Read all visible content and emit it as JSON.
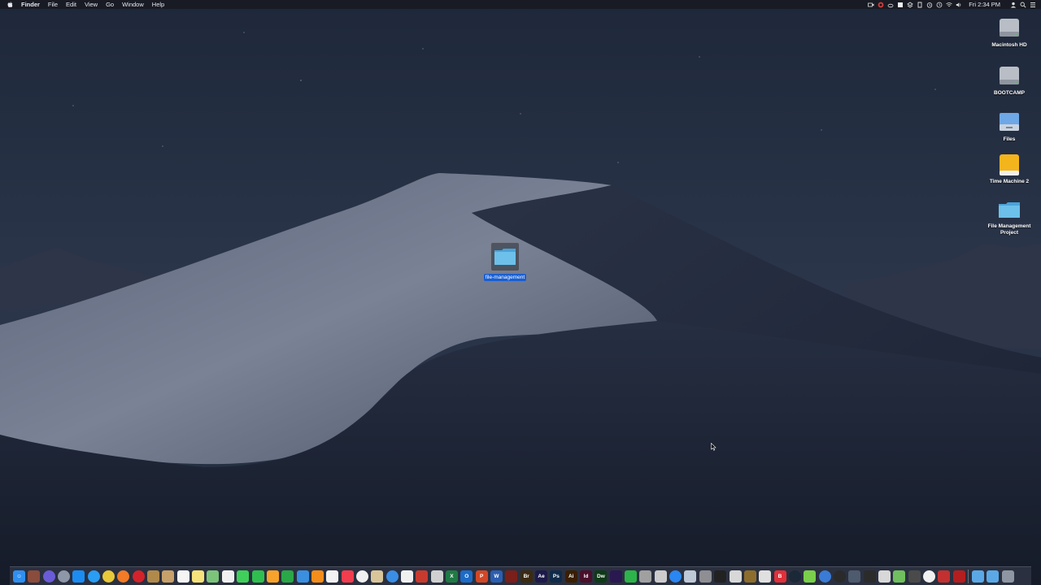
{
  "menubar": {
    "apple_icon": "apple-logo-icon",
    "items": [
      "Finder",
      "File",
      "Edit",
      "View",
      "Go",
      "Window",
      "Help"
    ],
    "status_icons": [
      "camera-icon",
      "creative-cloud-icon",
      "cloud-icon",
      "dropbox-icon",
      "box-icon",
      "backblaze-icon",
      "alarm-icon",
      "time-machine-icon",
      "wifi-icon",
      "volume-icon"
    ],
    "clock": "Fri 2:34 PM",
    "right_icons": [
      "user-icon",
      "spotlight-search-icon",
      "notification-center-icon"
    ]
  },
  "desktop_icons": [
    {
      "name": "macintosh-hd-drive",
      "label": "Macintosh HD",
      "kind": "internal-drive"
    },
    {
      "name": "bootcamp-drive",
      "label": "BOOTCAMP",
      "kind": "internal-drive"
    },
    {
      "name": "files-drive",
      "label": "Files",
      "kind": "network-drive"
    },
    {
      "name": "time-machine-drive",
      "label": "Time Machine 2",
      "kind": "external-drive"
    },
    {
      "name": "file-management-project-folder",
      "label": "File Management Project",
      "kind": "folder"
    }
  ],
  "selected_folder": {
    "label": "file-management"
  },
  "dock": {
    "apps": [
      {
        "name": "finder",
        "color": "#2f8ff0",
        "glyph": "☺"
      },
      {
        "name": "photo-booth",
        "color": "#8a4c3c",
        "glyph": ""
      },
      {
        "name": "siri",
        "color": "#6a5cd6",
        "glyph": ""
      },
      {
        "name": "launchpad",
        "color": "#8d97a8",
        "glyph": ""
      },
      {
        "name": "app-store-blue",
        "color": "#1b8cf2",
        "glyph": ""
      },
      {
        "name": "safari",
        "color": "#2a9df4",
        "glyph": ""
      },
      {
        "name": "chrome",
        "color": "#e8c93a",
        "glyph": ""
      },
      {
        "name": "firefox",
        "color": "#f17b26",
        "glyph": ""
      },
      {
        "name": "opera",
        "color": "#d4222b",
        "glyph": ""
      },
      {
        "name": "notes-brown",
        "color": "#b08a4a",
        "glyph": ""
      },
      {
        "name": "contacts",
        "color": "#c7a06a",
        "glyph": ""
      },
      {
        "name": "calendar",
        "color": "#f5f5f5",
        "glyph": ""
      },
      {
        "name": "notes",
        "color": "#f6e27a",
        "glyph": ""
      },
      {
        "name": "maps",
        "color": "#7cc47a",
        "glyph": ""
      },
      {
        "name": "photos",
        "color": "#f0f0f0",
        "glyph": ""
      },
      {
        "name": "messages",
        "color": "#3fcf5a",
        "glyph": ""
      },
      {
        "name": "facetime",
        "color": "#2fbf4f",
        "glyph": ""
      },
      {
        "name": "pages",
        "color": "#f7a32b",
        "glyph": ""
      },
      {
        "name": "numbers",
        "color": "#2aa747",
        "glyph": ""
      },
      {
        "name": "keynote",
        "color": "#3a8fe0",
        "glyph": ""
      },
      {
        "name": "ibooks",
        "color": "#f58d1a",
        "glyph": ""
      },
      {
        "name": "preview",
        "color": "#f2f2f2",
        "glyph": ""
      },
      {
        "name": "news",
        "color": "#f13d4d",
        "glyph": ""
      },
      {
        "name": "music",
        "color": "#f0f0f0",
        "glyph": ""
      },
      {
        "name": "folder-tool",
        "color": "#d9c59a",
        "glyph": ""
      },
      {
        "name": "quicktime",
        "color": "#3a8ee6",
        "glyph": ""
      },
      {
        "name": "textedit",
        "color": "#f0f0f0",
        "glyph": ""
      },
      {
        "name": "xcode-hammer",
        "color": "#c83a2e",
        "glyph": ""
      },
      {
        "name": "outline",
        "color": "#d0d0d0",
        "glyph": ""
      },
      {
        "name": "excel",
        "color": "#1f7a44",
        "glyph": "X"
      },
      {
        "name": "outlook",
        "color": "#1c6bc7",
        "glyph": "O"
      },
      {
        "name": "powerpoint",
        "color": "#d24726",
        "glyph": "P"
      },
      {
        "name": "word",
        "color": "#2b5eb1",
        "glyph": "W"
      },
      {
        "name": "acrobat",
        "color": "#7a1f1a",
        "glyph": ""
      },
      {
        "name": "bridge",
        "color": "#3c2a10",
        "glyph": "Br"
      },
      {
        "name": "after-effects",
        "color": "#1d1a4a",
        "glyph": "Ae"
      },
      {
        "name": "photoshop",
        "color": "#0f2b4a",
        "glyph": "Ps"
      },
      {
        "name": "illustrator",
        "color": "#3a1e00",
        "glyph": "Ai"
      },
      {
        "name": "indesign",
        "color": "#4a0f2b",
        "glyph": "Id"
      },
      {
        "name": "dreamweaver",
        "color": "#0e3a16",
        "glyph": "Dw"
      },
      {
        "name": "premiere",
        "color": "#2a1850",
        "glyph": ""
      },
      {
        "name": "evernote",
        "color": "#2db34a",
        "glyph": ""
      },
      {
        "name": "screen-capture",
        "color": "#a0a0a0",
        "glyph": ""
      },
      {
        "name": "script-editor",
        "color": "#cccccc",
        "glyph": ""
      },
      {
        "name": "app-store",
        "color": "#2a86f0",
        "glyph": ""
      },
      {
        "name": "mail",
        "color": "#bfc8d6",
        "glyph": ""
      },
      {
        "name": "system-preferences",
        "color": "#8e8e93",
        "glyph": ""
      },
      {
        "name": "terminal",
        "color": "#222222",
        "glyph": ""
      },
      {
        "name": "pen-tool",
        "color": "#d8d8d8",
        "glyph": ""
      },
      {
        "name": "handy-tool",
        "color": "#8d6d2d",
        "glyph": ""
      },
      {
        "name": "clipboard",
        "color": "#e0e0e0",
        "glyph": ""
      },
      {
        "name": "bear-b",
        "color": "#e0303a",
        "glyph": "B"
      },
      {
        "name": "steam",
        "color": "#1b2838",
        "glyph": ""
      },
      {
        "name": "bird-app",
        "color": "#7ad04a",
        "glyph": ""
      },
      {
        "name": "globe-app",
        "color": "#3a7bd5",
        "glyph": ""
      },
      {
        "name": "stopwatch",
        "color": "#2a2a2a",
        "glyph": ""
      },
      {
        "name": "monitor-app",
        "color": "#4e5a6e",
        "glyph": ""
      },
      {
        "name": "activity-monitor",
        "color": "#2b2b2b",
        "glyph": ""
      },
      {
        "name": "printer-app",
        "color": "#d8d8d8",
        "glyph": ""
      },
      {
        "name": "sheet-app",
        "color": "#6fbf5e",
        "glyph": ""
      },
      {
        "name": "calculator",
        "color": "#4a4a4a",
        "glyph": ""
      },
      {
        "name": "soccer-app",
        "color": "#f0f0f0",
        "glyph": ""
      },
      {
        "name": "sharp-tool",
        "color": "#c23030",
        "glyph": ""
      },
      {
        "name": "pdf-reader",
        "color": "#b51e1e",
        "glyph": ""
      }
    ],
    "right_items": [
      {
        "name": "downloads-folder",
        "color": "#5aa9e6"
      },
      {
        "name": "documents-folder",
        "color": "#5aa9e6"
      },
      {
        "name": "trash",
        "color": "#8e96a3"
      }
    ]
  }
}
